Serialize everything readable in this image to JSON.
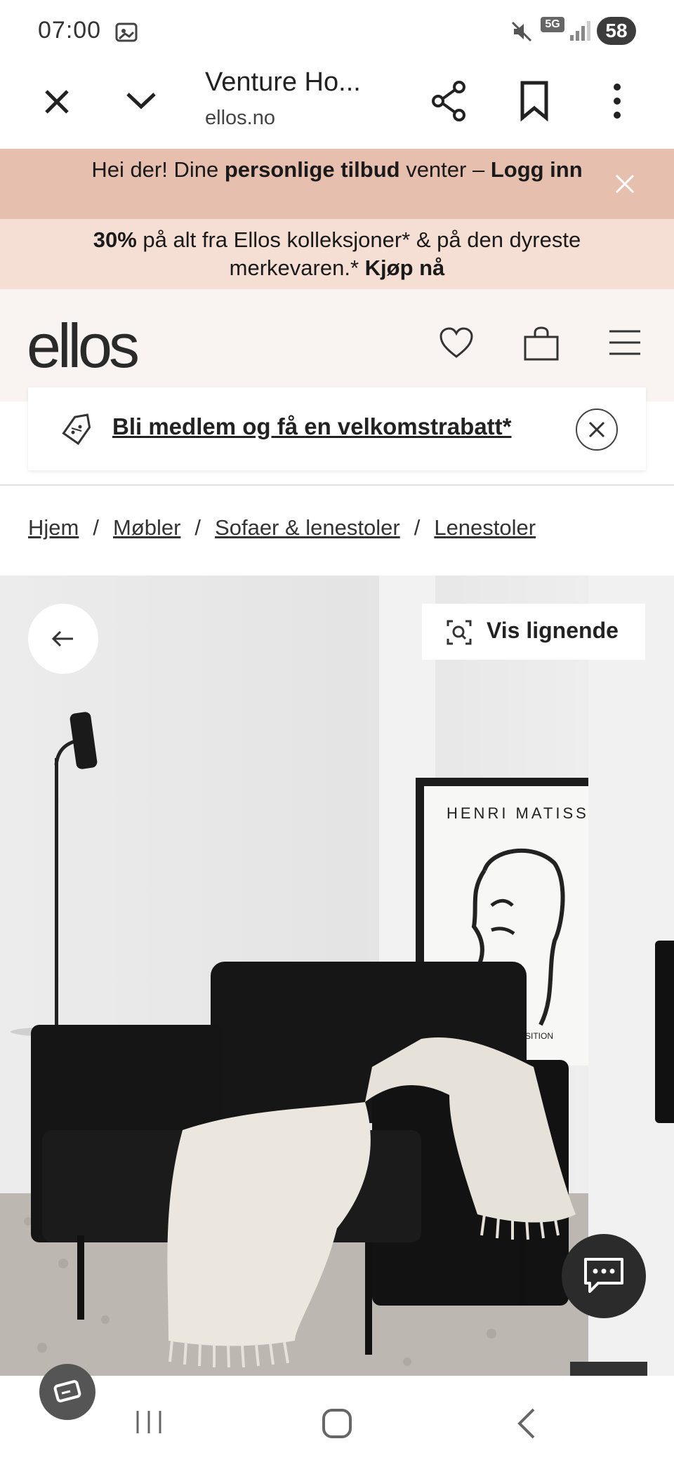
{
  "status_bar": {
    "time": "07:00",
    "battery": "58",
    "network": "5G"
  },
  "browser": {
    "title": "Venture Ho...",
    "url": "ellos.no"
  },
  "promo_login": {
    "part1": "Hei der! Dine ",
    "part2": "personlige tilbud",
    "part3": " venter – ",
    "part4": "Logg inn"
  },
  "promo_discount": {
    "part1": "30%",
    "part2": " på alt fra Ellos kolleksjoner* & på den dyreste merkevaren.* ",
    "part3": "Kjøp nå"
  },
  "header": {
    "logo": "ellos"
  },
  "membership": {
    "text": "Bli medlem og få en velkomstrabatt*"
  },
  "breadcrumb": {
    "items": [
      "Hjem",
      "Møbler",
      "Sofaer & lenestoler",
      "Lenestoler"
    ],
    "separator": "/"
  },
  "product_image": {
    "similar_label": "Vis lignende",
    "poster_text": "HENRI MATISS",
    "poster_caption": "SITION"
  },
  "colors": {
    "promo_login_bg": "#e7bfae",
    "promo_discount_bg": "#f5dfd5",
    "header_bg": "#f9f4f1",
    "chat_bg": "#2b2b2b"
  }
}
